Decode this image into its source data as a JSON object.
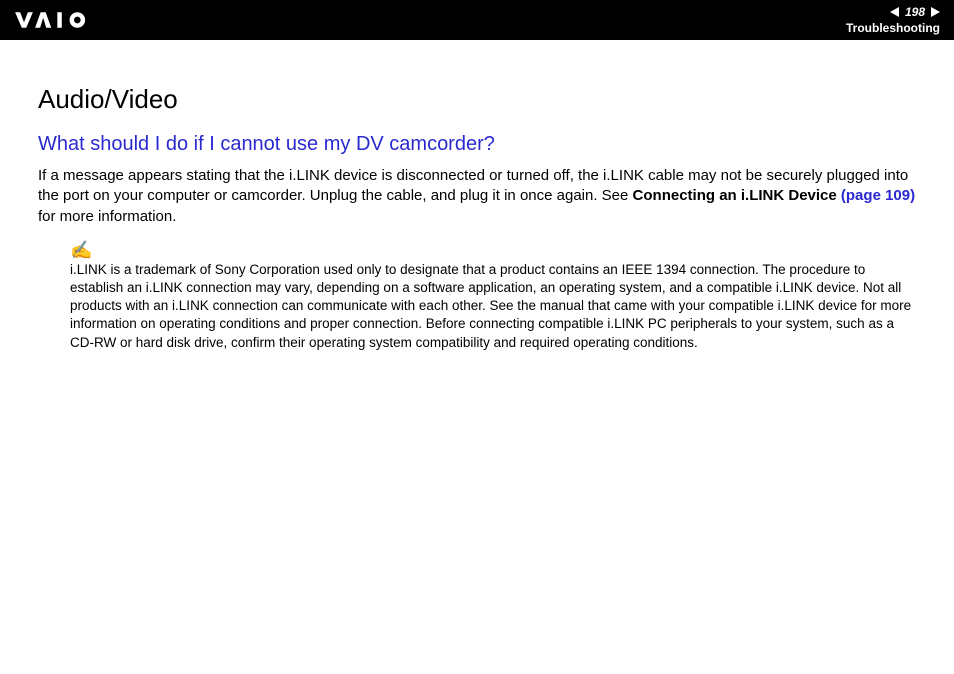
{
  "header": {
    "page_number": "198",
    "section": "Troubleshooting"
  },
  "content": {
    "title": "Audio/Video",
    "question": "What should I do if I cannot use my DV camcorder?",
    "body_pre": "If a message appears stating that the i.LINK device is disconnected or turned off, the i.LINK cable may not be securely plugged into the port on your computer or camcorder. Unplug the cable, and plug it in once again. See ",
    "body_bold": "Connecting an i.LINK Device",
    "body_link": " (page 109)",
    "body_post": " for more information.",
    "note_icon": "✍",
    "note": "i.LINK is a trademark of Sony Corporation used only to designate that a product contains an IEEE 1394 connection. The procedure to establish an i.LINK connection may vary, depending on a software application, an operating system, and a compatible i.LINK device. Not all products with an i.LINK connection can communicate with each other. See the manual that came with your compatible i.LINK device for more information on operating conditions and proper connection. Before connecting compatible i.LINK PC peripherals to your system, such as a CD-RW or hard disk drive, confirm their operating system compatibility and required operating conditions."
  }
}
